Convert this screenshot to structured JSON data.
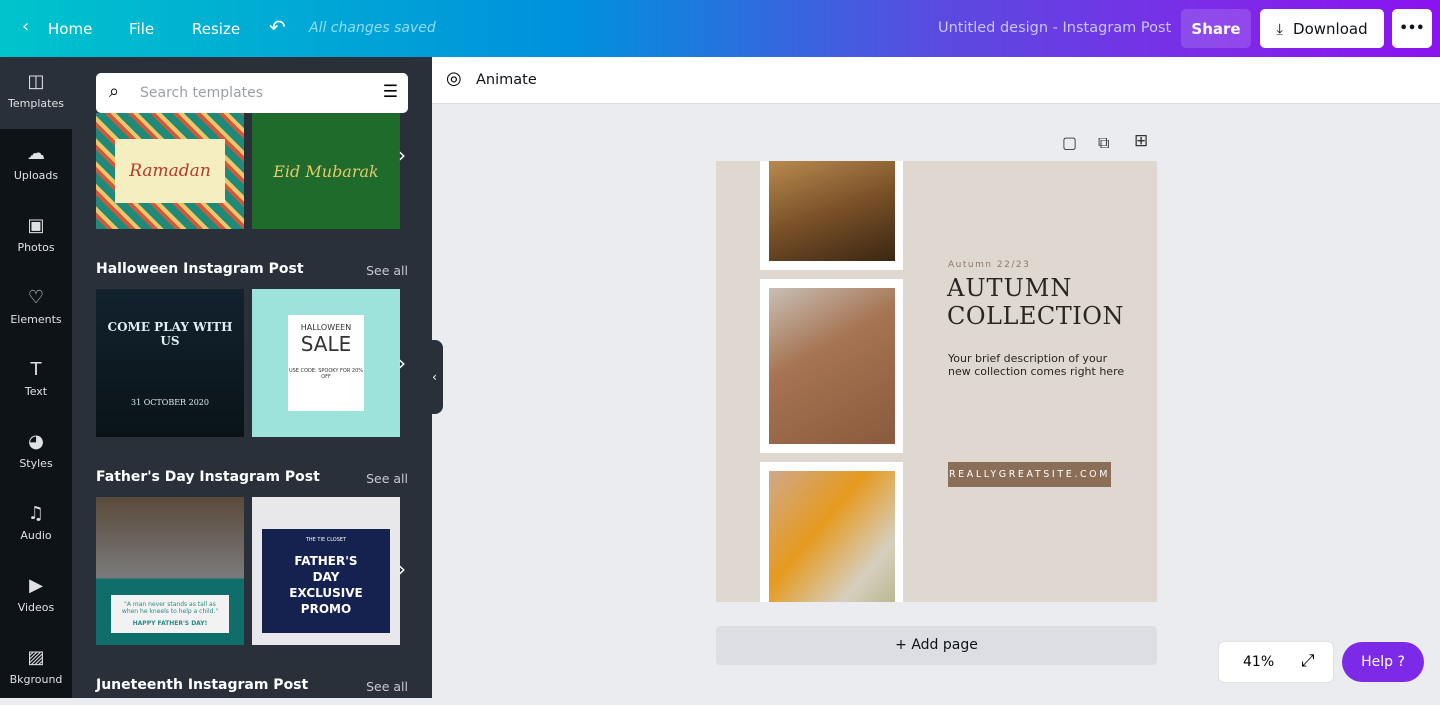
{
  "topbar": {
    "home": "Home",
    "file": "File",
    "resize": "Resize",
    "status": "All changes saved",
    "title": "Untitled design - Instagram Post",
    "share": "Share",
    "download": "Download",
    "more": "•••"
  },
  "rail": [
    {
      "label": "Templates",
      "icon": "templates-icon"
    },
    {
      "label": "Uploads",
      "icon": "upload-icon"
    },
    {
      "label": "Photos",
      "icon": "photo-icon"
    },
    {
      "label": "Elements",
      "icon": "elements-icon"
    },
    {
      "label": "Text",
      "icon": "text-icon"
    },
    {
      "label": "Styles",
      "icon": "palette-icon"
    },
    {
      "label": "Audio",
      "icon": "music-icon"
    },
    {
      "label": "Videos",
      "icon": "video-icon"
    },
    {
      "label": "Bkground",
      "icon": "background-icon"
    }
  ],
  "panel": {
    "search_placeholder": "Search templates",
    "see_all": "See all",
    "sections": [
      {
        "title": "Halloween Instagram Post"
      },
      {
        "title": "Father's Day Instagram Post"
      },
      {
        "title": "Juneteenth Instagram Post"
      }
    ],
    "thumbs": {
      "ramadan": "Ramadan",
      "eid": "Eid Mubarak",
      "halloween1_title": "COME PLAY WITH US",
      "halloween1_date": "31 OCTOBER 2020",
      "halloween2_top": "HALLOWEEN",
      "halloween2_main": "SALE",
      "halloween2_code": "USE CODE: SPOOKY FOR 20% OFF",
      "fathers1_quote": "\"A man never stands as tall as when he kneels to help a child.\"",
      "fathers1_foot": "HAPPY FATHER'S DAY!",
      "fathers2_top": "THE TIE CLOSET",
      "fathers2_main": "FATHER'S DAY EXCLUSIVE PROMO"
    }
  },
  "toolbar": {
    "animate": "Animate"
  },
  "design": {
    "kicker": "Autumn 22/23",
    "title1": "AUTUMN",
    "title2": "COLLECTION",
    "desc1": "Your brief description of your",
    "desc2": "new collection comes right here",
    "site": "REALLYGREATSITE.COM"
  },
  "add_page": "+ Add page",
  "zoom": "41%",
  "help": "Help ?",
  "colors": {
    "accent": "#7d2ae8",
    "panel": "#293039",
    "canvas": "#dfd8d1",
    "site_button": "#8b6e57"
  }
}
